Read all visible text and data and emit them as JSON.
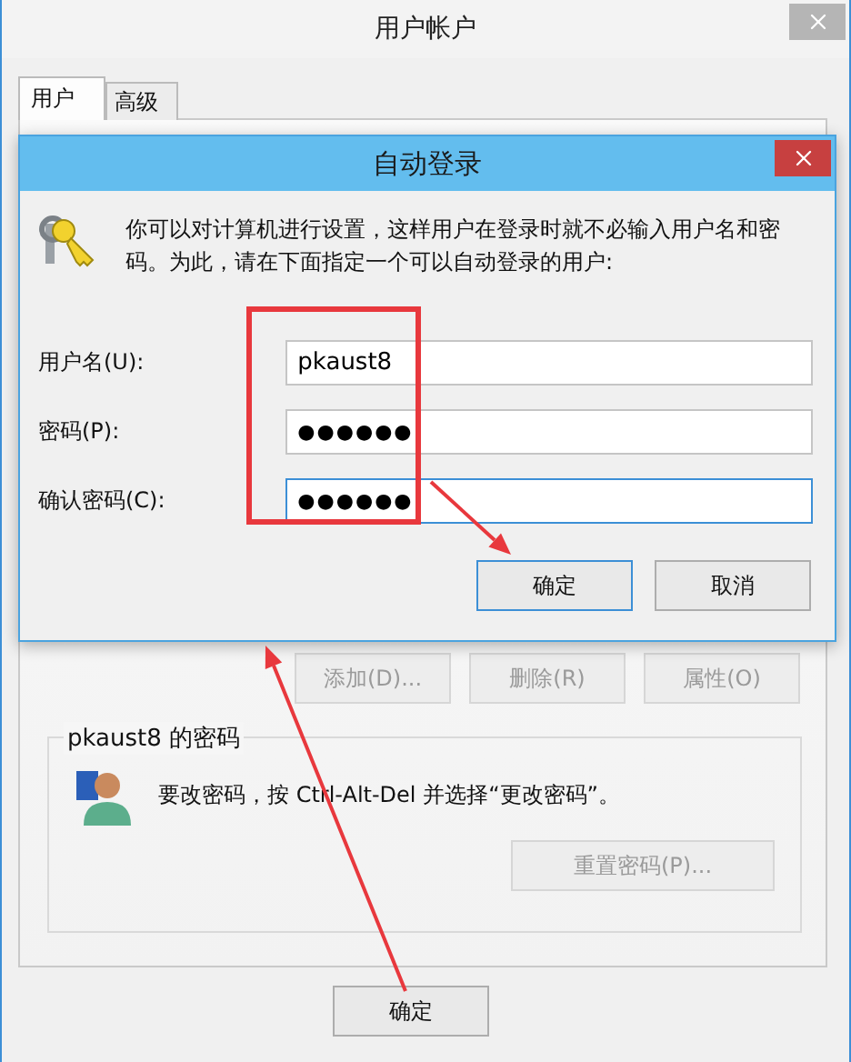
{
  "window": {
    "title": "用户帐户"
  },
  "tabs": [
    {
      "label": "用户",
      "selected": true
    },
    {
      "label": "高级",
      "selected": false
    }
  ],
  "user_buttons": [
    {
      "label": "添加(D)...",
      "disabled": true
    },
    {
      "label": "删除(R)",
      "disabled": true
    },
    {
      "label": "属性(O)",
      "disabled": true
    }
  ],
  "password_group": {
    "title": "pkaust8 的密码",
    "message": "要改密码，按 Ctrl-Alt-Del 并选择“更改密码”。",
    "reset_button": {
      "label": "重置密码(P)...",
      "disabled": true
    }
  },
  "footer_buttons": [
    {
      "label": "确定",
      "disabled": false
    }
  ],
  "dialog": {
    "title": "自动登录",
    "description": "你可以对计算机进行设置，这样用户在登录时就不必输入用户名和密码。为此，请在下面指定一个可以自动登录的用户:",
    "fields": [
      {
        "label": "用户名(U):",
        "value": "pkaust8",
        "kind": "text",
        "focused": false
      },
      {
        "label": "密码(P):",
        "value": "●●●●●●",
        "kind": "password",
        "focused": false
      },
      {
        "label": "确认密码(C):",
        "value": "●●●●●●",
        "kind": "password",
        "focused": true
      }
    ],
    "buttons": [
      {
        "label": "确定",
        "default": true
      },
      {
        "label": "取消",
        "default": false
      }
    ]
  }
}
